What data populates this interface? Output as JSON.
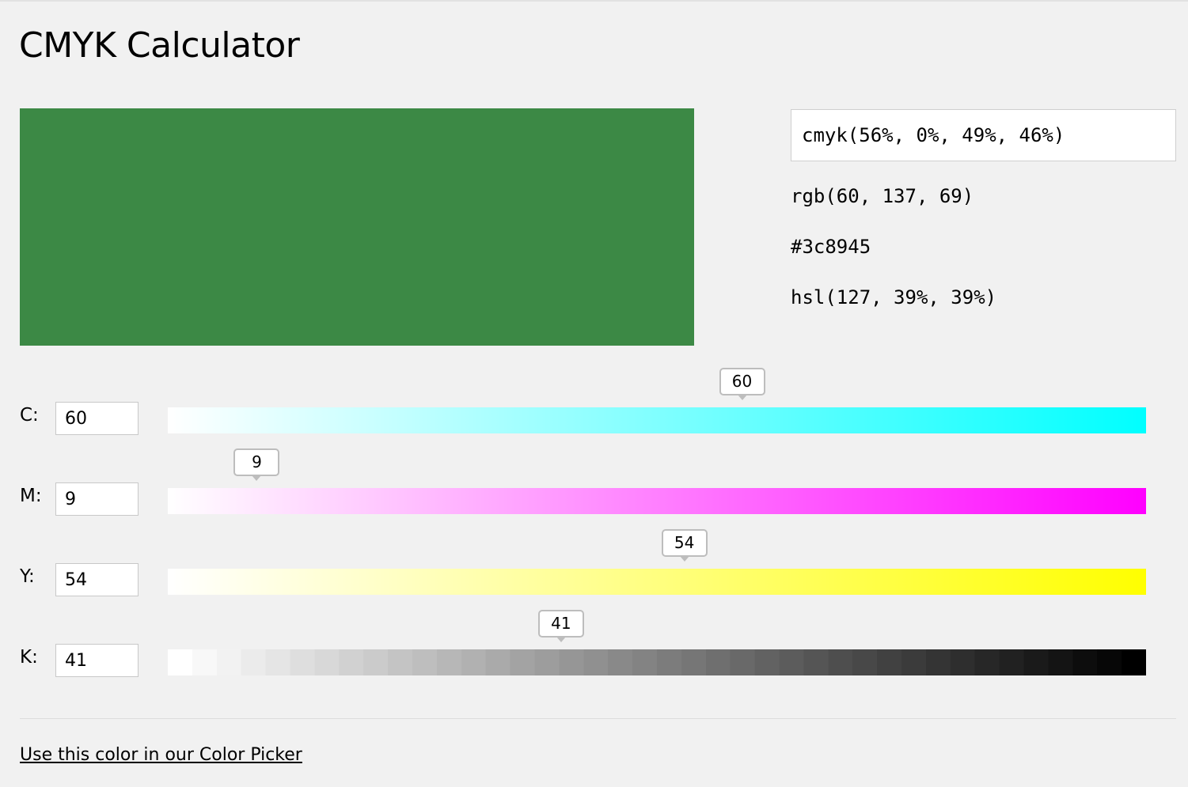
{
  "page": {
    "title": "CMYK Calculator"
  },
  "swatch": {
    "color": "#3c8945"
  },
  "output": {
    "cmyk": "cmyk(56%, 0%, 49%, 46%)",
    "rgb": "rgb(60, 137, 69)",
    "hex": "#3c8945",
    "hsl": "hsl(127, 39%, 39%)"
  },
  "sliders": [
    {
      "label": "C:",
      "value": "60",
      "fraction": 0.587,
      "gradient_end": "#00ffff"
    },
    {
      "label": "M:",
      "value": "9",
      "fraction": 0.091,
      "gradient_end": "#ff00ff"
    },
    {
      "label": "Y:",
      "value": "54",
      "fraction": 0.528,
      "gradient_end": "#ffff00"
    },
    {
      "label": "K:",
      "value": "41",
      "fraction": 0.402,
      "gradient_end": "#000000"
    }
  ],
  "footer": {
    "link_text": "Use this color in our Color Picker"
  }
}
